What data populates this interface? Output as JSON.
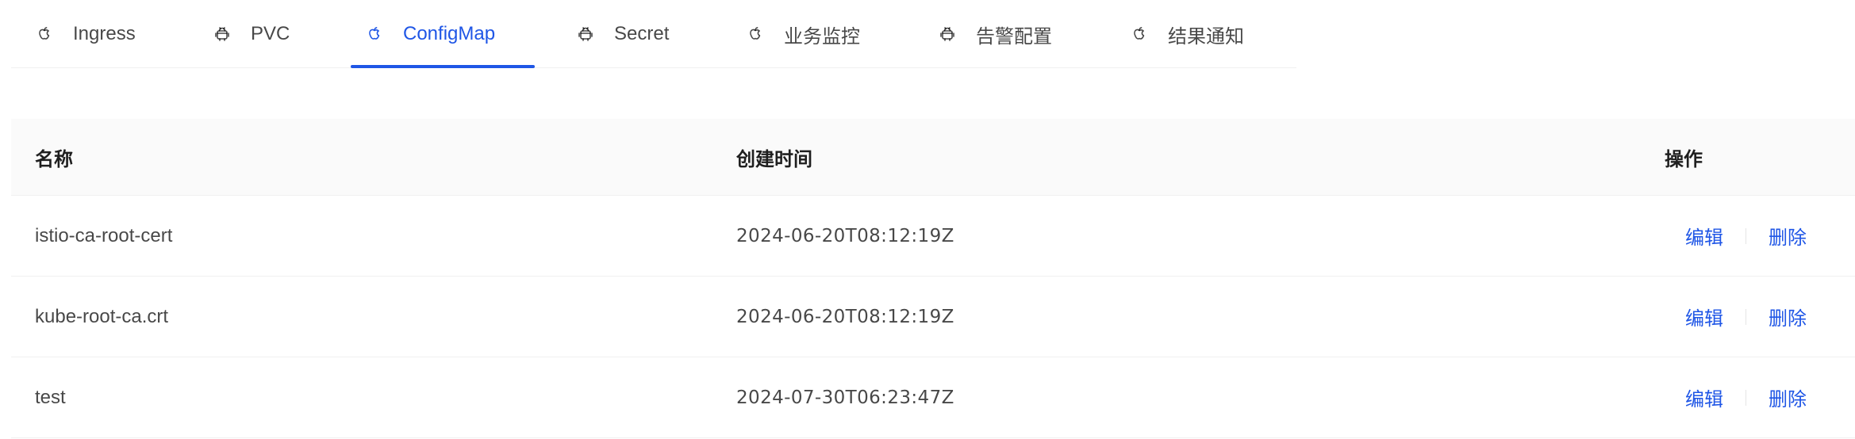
{
  "tabs": [
    {
      "label": "Ingress",
      "icon": "apple-icon"
    },
    {
      "label": "PVC",
      "icon": "android-icon"
    },
    {
      "label": "ConfigMap",
      "icon": "apple-icon",
      "active": true
    },
    {
      "label": "Secret",
      "icon": "android-icon"
    },
    {
      "label": "业务监控",
      "icon": "apple-icon"
    },
    {
      "label": "告警配置",
      "icon": "android-icon"
    },
    {
      "label": "结果通知",
      "icon": "apple-icon"
    }
  ],
  "table": {
    "columns": [
      "名称",
      "创建时间",
      "操作"
    ],
    "rows": [
      {
        "name": "istio-ca-root-cert",
        "created": "2024-06-20T08:12:19Z"
      },
      {
        "name": "kube-root-ca.crt",
        "created": "2024-06-20T08:12:19Z"
      },
      {
        "name": "test",
        "created": "2024-07-30T06:23:47Z"
      }
    ],
    "actions": {
      "edit": "编辑",
      "delete": "删除"
    }
  },
  "colors": {
    "accent": "#1f56e6",
    "header_bg": "#fafafa",
    "border": "#f0f0f0"
  }
}
